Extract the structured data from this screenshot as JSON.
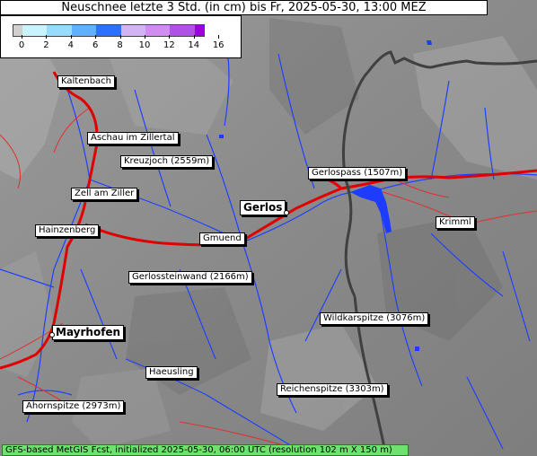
{
  "title": "Neuschnee letzte 3 Std. (in cm) bis Fr, 2025-05-30, 13:00 MEZ",
  "legend": {
    "ticks": [
      "0",
      "2",
      "4",
      "6",
      "8",
      "10",
      "12",
      "14",
      "16"
    ],
    "colors": [
      "#d0d0d0",
      "#c9f4ff",
      "#96dcff",
      "#5fb0ff",
      "#2c70ff",
      "#d2b4f5",
      "#d08cf0",
      "#b050e6",
      "#9c00e0"
    ]
  },
  "places": {
    "kaltenbach": "Kaltenbach",
    "aschau": "Aschau im Zillertal",
    "kreuzjoch": "Kreuzjoch (2559m)",
    "gerlospass": "Gerlospass (1507m)",
    "zell": "Zell am Ziller",
    "gerlos": "Gerlos",
    "krimml": "Krimml",
    "hainzenberg": "Hainzenberg",
    "gmuend": "Gmuend",
    "gerlossteinwand": "Gerlossteinwand (2166m)",
    "wildkarspitze": "Wildkarspitze (3076m)",
    "mayrhofen": "Mayrhofen",
    "haeusling": "Haeusling",
    "reichenspitze": "Reichenspitze (3303m)",
    "ahornspitze": "Ahornspitze (2973m)"
  },
  "footer": "GFS-based MetGIS Fcst, initialized 2025-05-30, 06:00 UTC  (resolution 102 m X 150 m)",
  "colors": {
    "road_main": "#e00000",
    "road_minor": "#e03030",
    "rivers": "#2040ff",
    "border": "#404040",
    "snow_patch": "#1e3cff",
    "footer_bg": "#6ee26e"
  }
}
